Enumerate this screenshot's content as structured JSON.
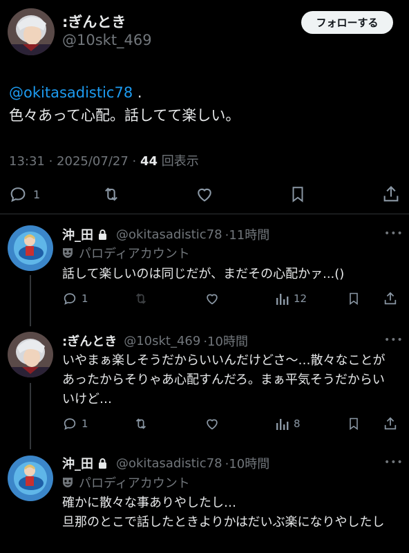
{
  "main_tweet": {
    "author_name": ":ぎんとき",
    "author_handle": "@10skt_469",
    "follow_label": "フォローする",
    "mention": "@okitasadistic78",
    "mention_suffix": " .",
    "body": "色々あって心配。話してて楽しい。",
    "timestamp": "13:31 · 2025/07/27 · ",
    "views_count": "44",
    "views_label": " 回表示",
    "reply_count": "1"
  },
  "replies": [
    {
      "author_name": "沖_田",
      "author_handle": "@okitasadistic78",
      "time": "·11時間",
      "parody_label": "パロディアカウント",
      "body": "話して楽しいのは同じだが、まだその心配かァ...()",
      "reply_count": "1",
      "views": "12",
      "more": "•••"
    },
    {
      "author_name": ":ぎんとき",
      "author_handle": "@10skt_469",
      "time": "·10時間",
      "body": "いやまぁ楽しそうだからいいんだけどさ〜…散々なことがあったからそりゃあ心配すんだろ。まぁ平気そうだからいいけど…",
      "reply_count": "1",
      "views": "8",
      "more": "•••"
    },
    {
      "author_name": "沖_田",
      "author_handle": "@okitasadistic78",
      "time": "·10時間",
      "parody_label": "パロディアカウント",
      "body_line1": "確かに散々な事ありやしたし…",
      "body_line2": "旦那のとこで話したときよりかはだいぶ楽になりやしたし",
      "more": "•••"
    }
  ],
  "icons": [
    "reply-icon",
    "retweet-icon",
    "like-icon",
    "bookmark-icon",
    "share-icon",
    "views-icon",
    "lock-icon",
    "parody-mask-icon",
    "more-icon"
  ],
  "colors": {
    "background": "#000000",
    "accent": "#1d9bf0",
    "muted": "#71767b",
    "text": "#e7e9ea"
  }
}
